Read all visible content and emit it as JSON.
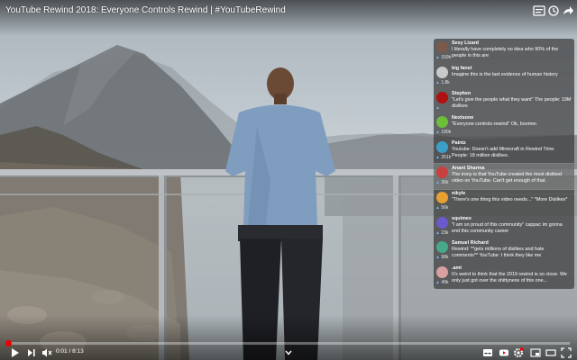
{
  "video": {
    "title": "YouTube Rewind 2018: Everyone Controls Rewind | #YouTubeRewind",
    "time_current": "0:01",
    "time_total": "8:13",
    "time_separator": " / ",
    "progress_fraction": 0.002
  },
  "top_icons": [
    "chat-toggle-icon",
    "watch-later-icon",
    "share-icon"
  ],
  "chat": [
    {
      "name": "Sexy Lizard",
      "text": "I literally have completely no idea who 90% of the people in this are",
      "likes": "159k",
      "color": "#7a5a4a"
    },
    {
      "name": "big fanst",
      "text": "Imagine this is the last evidence of human history",
      "likes": "1.8k",
      "color": "#c9c9c9"
    },
    {
      "name": "Stephen",
      "text": "\"Let's give the people what they want\" The people: 19M dislikes",
      "likes": "",
      "color": "#b01010"
    },
    {
      "name": "Nextsone",
      "text": "\"Everyone controls rewind\" Ok, boomer.",
      "likes": "190k",
      "color": "#6cbf3a"
    },
    {
      "name": "Paintz",
      "text": "Youtube: Doesn't add Minecraft in Rewind Time. People: 18 million dislikes.",
      "likes": "251k",
      "color": "#3aa0c8"
    },
    {
      "name": "Anant Sharma",
      "text": "The irony is that YouTube created the most disliked video on YouTube. Can't get enough of that.",
      "likes": "36k",
      "color": "#c84040"
    },
    {
      "name": "nikyle",
      "text": "\"There's one thing this video needs...\" *More Dislikes*",
      "likes": "56k",
      "color": "#e8a030"
    },
    {
      "name": "squimex",
      "text": "\"I am so proud of this community\" cappac im gonna end this community career",
      "likes": "23k",
      "color": "#6a5acd"
    },
    {
      "name": "Samuel Richard",
      "text": "Rewind: **gets millions of dislikes and hate comments** YouTube: I think they like me",
      "likes": "98k",
      "color": "#4aa88a"
    },
    {
      "name": ".amt",
      "text": "It's weird to think that the 2019 rewind is so close. We only just got over the shittyness of this one...",
      "likes": "49k",
      "color": "#d9a0a0"
    }
  ],
  "highlighted_message_index": 5,
  "controls": {
    "play_icon": "play-icon",
    "next_icon": "next-icon",
    "volume_icon": "volume-muted-icon",
    "chevron_icon": "chevron-down-icon",
    "right_icons": [
      "subtitles-icon",
      "youtube-logo-icon",
      "settings-icon",
      "miniplayer-icon",
      "theater-icon",
      "fullscreen-icon"
    ]
  }
}
